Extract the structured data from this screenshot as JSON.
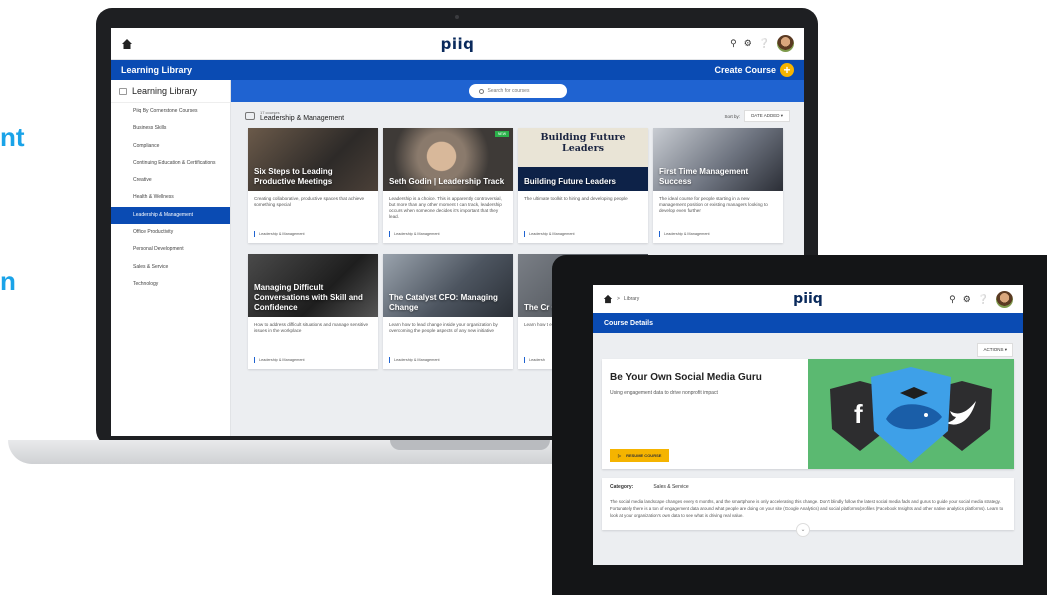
{
  "left_fragments": [
    "nt",
    "n"
  ],
  "laptop": {
    "logo": "piiq",
    "header_title": "Learning Library",
    "create_course_label": "Create Course",
    "sidebar_title": "Learning Library",
    "sidebar_items": [
      "Piiq By Cornerstone Courses",
      "Business Skills",
      "Compliance",
      "Continuing Education & Certifications",
      "Creative",
      "Health & Wellness",
      "Leadership & Management",
      "Office Productivity",
      "Personal Development",
      "Sales & Service",
      "Technology"
    ],
    "active_sidebar_index": 6,
    "search_placeholder": "Search for courses",
    "category_count": "17 courses",
    "category_name": "Leadership & Management",
    "sort_label": "Sort by:",
    "sort_value": "DATE ADDED",
    "cards": [
      {
        "title": "Six Steps to Leading Productive Meetings",
        "desc": "Creating collaborative, productive spaces that achieve something special",
        "tag": "Leadership & Management"
      },
      {
        "title": "Seth Godin | Leadership Track",
        "desc": "Leadership is a choice. This is apparently controversial, but more than any other moment I can track, leadership occurs when someone decides it's important that they lead.",
        "tag": "Leadership & Management",
        "badge": "NEW"
      },
      {
        "title": "Building Future Leaders",
        "image_text": "Building Future Leaders",
        "desc": "The ultimate toolkit to hiring and developing people",
        "tag": "Leadership & Management"
      },
      {
        "title": "First Time Management Success",
        "desc": "The ideal course for people starting in a new management position or existing managers looking to develop even further",
        "tag": "Leadership & Management"
      },
      {
        "title": "Managing Difficult Conversations with Skill and Confidence",
        "desc": "How to address difficult situations and manage sensitive issues in the workplace",
        "tag": "Leadership & Management"
      },
      {
        "title": "The Catalyst CFO: Managing Change",
        "desc": "Learn how to lead change inside your organization by overcoming the people aspects of any new initiative",
        "tag": "Leadership & Management"
      },
      {
        "title": "The Cr Growth Predict",
        "desc": "Learn how t executive w stakeholde",
        "tag": "Leadersh"
      }
    ]
  },
  "tablet": {
    "logo": "piiq",
    "breadcrumb": "Library",
    "section_title": "Course Details",
    "actions_label": "ACTIONS",
    "course_title": "Be Your Own Social Media Guru",
    "course_subtitle": "Using engagement data to drive nonprofit impact",
    "resume_label": "RESUME COURSE",
    "category_label": "Category:",
    "category_value": "Sales & Service",
    "description": "The social media landscape changes every 6 months, and the smartphone is only accelerating this change. Don't blindly follow the latest social media fads and gurus to guide your social media strategy. Fortunately there is a ton of engagement data around what people are doing on your site (Google Analytics) and social platforms/profiles (Facebook Insights and other native analytics platforms). Learn to look at your organization's own data to see what is driving real value."
  },
  "colors": {
    "brand_blue": "#0a4bb3",
    "accent_yellow": "#f5b400",
    "hero_green": "#5bb971"
  }
}
